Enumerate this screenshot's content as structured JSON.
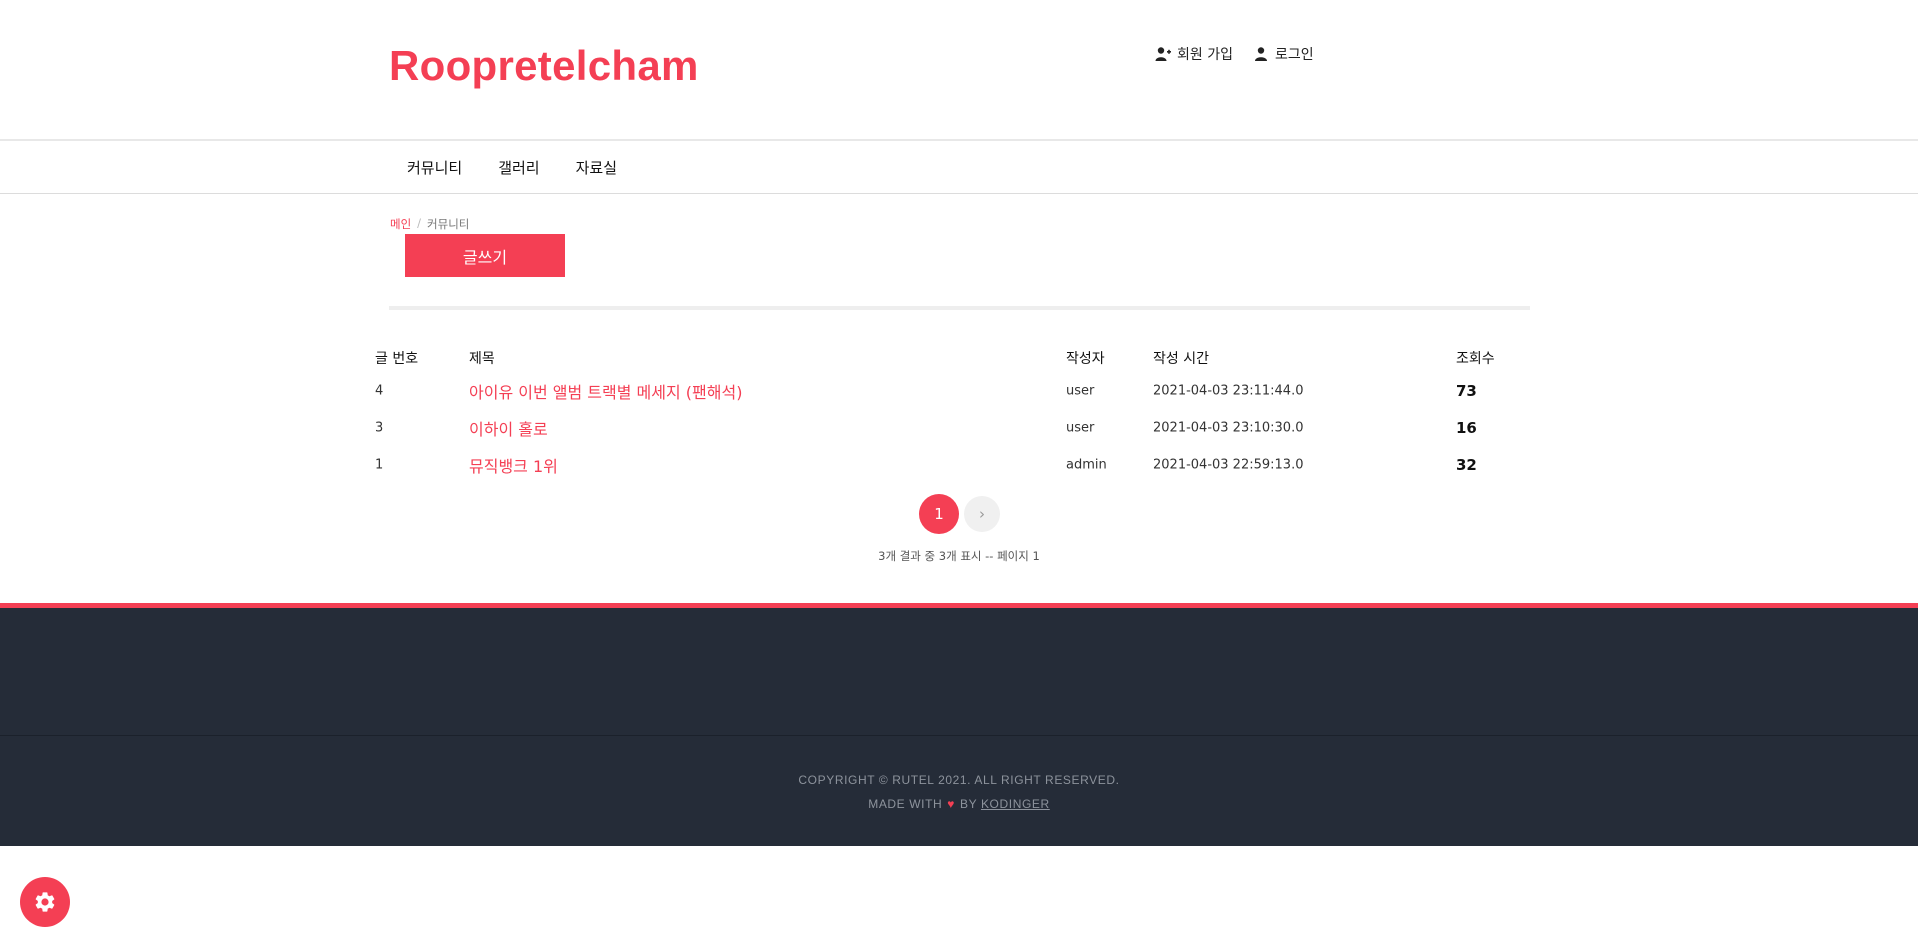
{
  "header": {
    "brand": "Roopretelcham",
    "signup_label": "회원 가입",
    "login_label": "로그인"
  },
  "nav": {
    "items": [
      {
        "label": "커뮤니티"
      },
      {
        "label": "갤러리"
      },
      {
        "label": "자료실"
      }
    ]
  },
  "breadcrumb": {
    "home": "메인",
    "separator": "/",
    "current": "커뮤니티"
  },
  "write_button": "글쓰기",
  "table": {
    "headers": {
      "num": "글 번호",
      "title": "제목",
      "author": "작성자",
      "time": "작성 시간",
      "views": "조회수"
    },
    "rows": [
      {
        "num": "4",
        "title": "아이유 이번 앨범 트랙별 메세지 (팬해석)",
        "author": "user",
        "time": "2021-04-03 23:11:44.0",
        "views": "73"
      },
      {
        "num": "3",
        "title": "이하이 홀로",
        "author": "user",
        "time": "2021-04-03 23:10:30.0",
        "views": "16"
      },
      {
        "num": "1",
        "title": "뮤직뱅크 1위",
        "author": "admin",
        "time": "2021-04-03 22:59:13.0",
        "views": "32"
      }
    ]
  },
  "pagination": {
    "current_page": "1",
    "next_symbol": "›",
    "result_text": "3개 결과 중 3개 표시 -- 페이지 1"
  },
  "footer": {
    "copyright": "COPYRIGHT © RUTEL 2021. ALL RIGHT RESERVED.",
    "made_with": "MADE WITH",
    "heart": "♥",
    "by": "BY",
    "author_link": "KODINGER"
  },
  "colors": {
    "accent": "#f43f54",
    "footer_bg": "#252c38"
  },
  "icons": {
    "signup": "user-plus-icon",
    "login": "user-icon",
    "settings": "gear-icon"
  }
}
